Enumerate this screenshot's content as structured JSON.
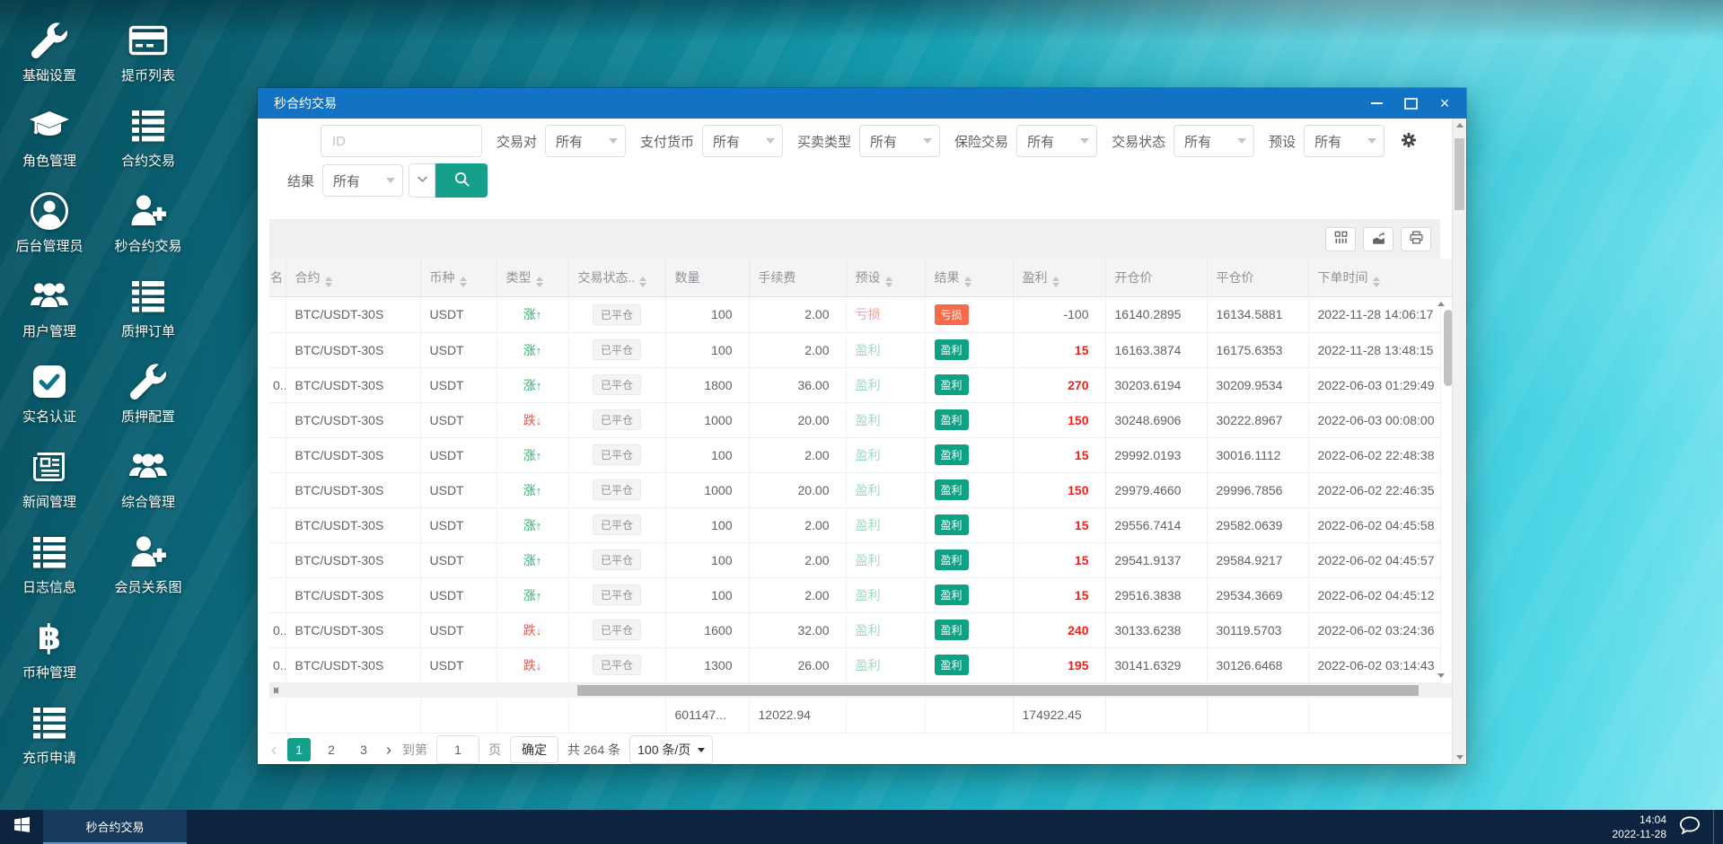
{
  "desktop": {
    "icons": [
      {
        "id": "base-settings",
        "label": "基础设置",
        "icon": "wrench-icon"
      },
      {
        "id": "role-manage",
        "label": "角色管理",
        "icon": "graduation-cap-icon"
      },
      {
        "id": "admin-manage",
        "label": "后台管理员",
        "icon": "user-circle-icon"
      },
      {
        "id": "user-manage",
        "label": "用户管理",
        "icon": "users-icon"
      },
      {
        "id": "kyc-verify",
        "label": "实名认证",
        "icon": "check-square-icon"
      },
      {
        "id": "news-manage",
        "label": "新闻管理",
        "icon": "newspaper-icon"
      },
      {
        "id": "log-info",
        "label": "日志信息",
        "icon": "list-icon"
      },
      {
        "id": "coin-manage",
        "label": "币种管理",
        "icon": "bitcoin-icon"
      },
      {
        "id": "deposit-request",
        "label": "充币申请",
        "icon": "list-icon"
      },
      {
        "id": "withdraw-list",
        "label": "提币列表",
        "icon": "card-icon"
      },
      {
        "id": "contract-trade",
        "label": "合约交易",
        "icon": "list-icon"
      },
      {
        "id": "second-contract",
        "label": "秒合约交易",
        "icon": "user-plus-icon"
      },
      {
        "id": "pledge-orders",
        "label": "质押订单",
        "icon": "list-icon"
      },
      {
        "id": "pledge-config",
        "label": "质押配置",
        "icon": "wrench-icon"
      },
      {
        "id": "general-manage",
        "label": "综合管理",
        "icon": "users-icon"
      },
      {
        "id": "member-graph",
        "label": "会员关系图",
        "icon": "user-plus-icon"
      }
    ]
  },
  "window": {
    "title": "秒合约交易",
    "filters": {
      "id_placeholder": "ID",
      "row1": [
        {
          "name": "pair",
          "label": "交易对",
          "value": "所有"
        },
        {
          "name": "currency",
          "label": "支付货币",
          "value": "所有"
        },
        {
          "name": "trade-type",
          "label": "买卖类型",
          "value": "所有"
        },
        {
          "name": "insurance",
          "label": "保险交易",
          "value": "所有"
        },
        {
          "name": "status",
          "label": "交易状态",
          "value": "所有"
        },
        {
          "name": "preset",
          "label": "预设",
          "value": "所有"
        }
      ],
      "result_label": "结果",
      "result_value": "所有"
    },
    "toolbar": {
      "buttons": [
        "columns-icon",
        "export-icon",
        "print-icon"
      ]
    },
    "table": {
      "columns": [
        {
          "label": "名",
          "sortable": false
        },
        {
          "label": "合约",
          "sortable": true
        },
        {
          "label": "币种",
          "sortable": true
        },
        {
          "label": "类型",
          "sortable": true
        },
        {
          "label": "交易状态..",
          "sortable": true
        },
        {
          "label": "数量",
          "sortable": false
        },
        {
          "label": "手续费",
          "sortable": false
        },
        {
          "label": "预设",
          "sortable": true
        },
        {
          "label": "结果",
          "sortable": true
        },
        {
          "label": "盈利",
          "sortable": true
        },
        {
          "label": "开仓价",
          "sortable": false
        },
        {
          "label": "平仓价",
          "sortable": false
        },
        {
          "label": "下单时间",
          "sortable": true
        }
      ],
      "rows": [
        {
          "user": "",
          "contract": "BTC/USDT-30S",
          "coin": "USDT",
          "direction": "涨",
          "status": "已平仓",
          "qty": "100",
          "fee": "2.00",
          "preset": "亏损",
          "result": "亏损",
          "profit": "-100",
          "open": "16140.2895",
          "close": "16134.5881",
          "time": "2022-11-28 14:06:17",
          "tint": "white"
        },
        {
          "user": "",
          "contract": "BTC/USDT-30S",
          "coin": "USDT",
          "direction": "涨",
          "status": "已平仓",
          "qty": "100",
          "fee": "2.00",
          "preset": "盈利",
          "result": "盈利",
          "profit": "15",
          "open": "16163.3874",
          "close": "16175.6353",
          "time": "2022-11-28 13:48:15",
          "tint": "green"
        },
        {
          "user": "0...",
          "contract": "BTC/USDT-30S",
          "coin": "USDT",
          "direction": "涨",
          "status": "已平仓",
          "qty": "1800",
          "fee": "36.00",
          "preset": "盈利",
          "result": "盈利",
          "profit": "270",
          "open": "30203.6194",
          "close": "30209.9534",
          "time": "2022-06-03 01:29:49",
          "tint": "green"
        },
        {
          "user": "",
          "contract": "BTC/USDT-30S",
          "coin": "USDT",
          "direction": "跌",
          "status": "已平仓",
          "qty": "1000",
          "fee": "20.00",
          "preset": "盈利",
          "result": "盈利",
          "profit": "150",
          "open": "30248.6906",
          "close": "30222.8967",
          "time": "2022-06-03 00:08:00",
          "tint": "pink"
        },
        {
          "user": "",
          "contract": "BTC/USDT-30S",
          "coin": "USDT",
          "direction": "涨",
          "status": "已平仓",
          "qty": "100",
          "fee": "2.00",
          "preset": "盈利",
          "result": "盈利",
          "profit": "15",
          "open": "29992.0193",
          "close": "30016.1112",
          "time": "2022-06-02 22:48:38",
          "tint": "white"
        },
        {
          "user": "",
          "contract": "BTC/USDT-30S",
          "coin": "USDT",
          "direction": "涨",
          "status": "已平仓",
          "qty": "1000",
          "fee": "20.00",
          "preset": "盈利",
          "result": "盈利",
          "profit": "150",
          "open": "29979.4660",
          "close": "29996.7856",
          "time": "2022-06-02 22:46:35",
          "tint": "green"
        },
        {
          "user": "",
          "contract": "BTC/USDT-30S",
          "coin": "USDT",
          "direction": "涨",
          "status": "已平仓",
          "qty": "100",
          "fee": "2.00",
          "preset": "盈利",
          "result": "盈利",
          "profit": "15",
          "open": "29556.7414",
          "close": "29582.0639",
          "time": "2022-06-02 04:45:58",
          "tint": "green"
        },
        {
          "user": "",
          "contract": "BTC/USDT-30S",
          "coin": "USDT",
          "direction": "涨",
          "status": "已平仓",
          "qty": "100",
          "fee": "2.00",
          "preset": "盈利",
          "result": "盈利",
          "profit": "15",
          "open": "29541.9137",
          "close": "29584.9217",
          "time": "2022-06-02 04:45:57",
          "tint": "white"
        },
        {
          "user": "",
          "contract": "BTC/USDT-30S",
          "coin": "USDT",
          "direction": "涨",
          "status": "已平仓",
          "qty": "100",
          "fee": "2.00",
          "preset": "盈利",
          "result": "盈利",
          "profit": "15",
          "open": "29516.3838",
          "close": "29534.3669",
          "time": "2022-06-02 04:45:12",
          "tint": "green"
        },
        {
          "user": "0...",
          "contract": "BTC/USDT-30S",
          "coin": "USDT",
          "direction": "跌",
          "status": "已平仓",
          "qty": "1600",
          "fee": "32.00",
          "preset": "盈利",
          "result": "盈利",
          "profit": "240",
          "open": "30133.6238",
          "close": "30119.5703",
          "time": "2022-06-02 03:24:36",
          "tint": "pink"
        },
        {
          "user": "0...",
          "contract": "BTC/USDT-30S",
          "coin": "USDT",
          "direction": "跌",
          "status": "已平仓",
          "qty": "1300",
          "fee": "26.00",
          "preset": "盈利",
          "result": "盈利",
          "profit": "195",
          "open": "30141.6329",
          "close": "30126.6468",
          "time": "2022-06-02 03:14:43",
          "tint": "pink"
        }
      ],
      "summary": {
        "quantity": "601147...",
        "fee": "12022.94",
        "profit": "174922.45"
      }
    },
    "pagination": {
      "pages": [
        "1",
        "2",
        "3"
      ],
      "current": "1",
      "goto_label": "到第",
      "goto_value": "1",
      "page_label": "页",
      "confirm_label": "确定",
      "total_label": "共 264 条",
      "per_page": "100 条/页"
    }
  },
  "taskbar": {
    "task": "秒合约交易",
    "time": "14:04",
    "date": "2022-11-28"
  },
  "colors": {
    "titlebar_blue": "#1273c4",
    "accent_teal": "#14a08b",
    "win_badge": "#0fa183",
    "loss_badge": "#f56b4b",
    "up_green": "#27b36a",
    "down_red": "#e8584e",
    "profit_red": "#f2201d",
    "taskbar_navy": "#0c2440"
  }
}
